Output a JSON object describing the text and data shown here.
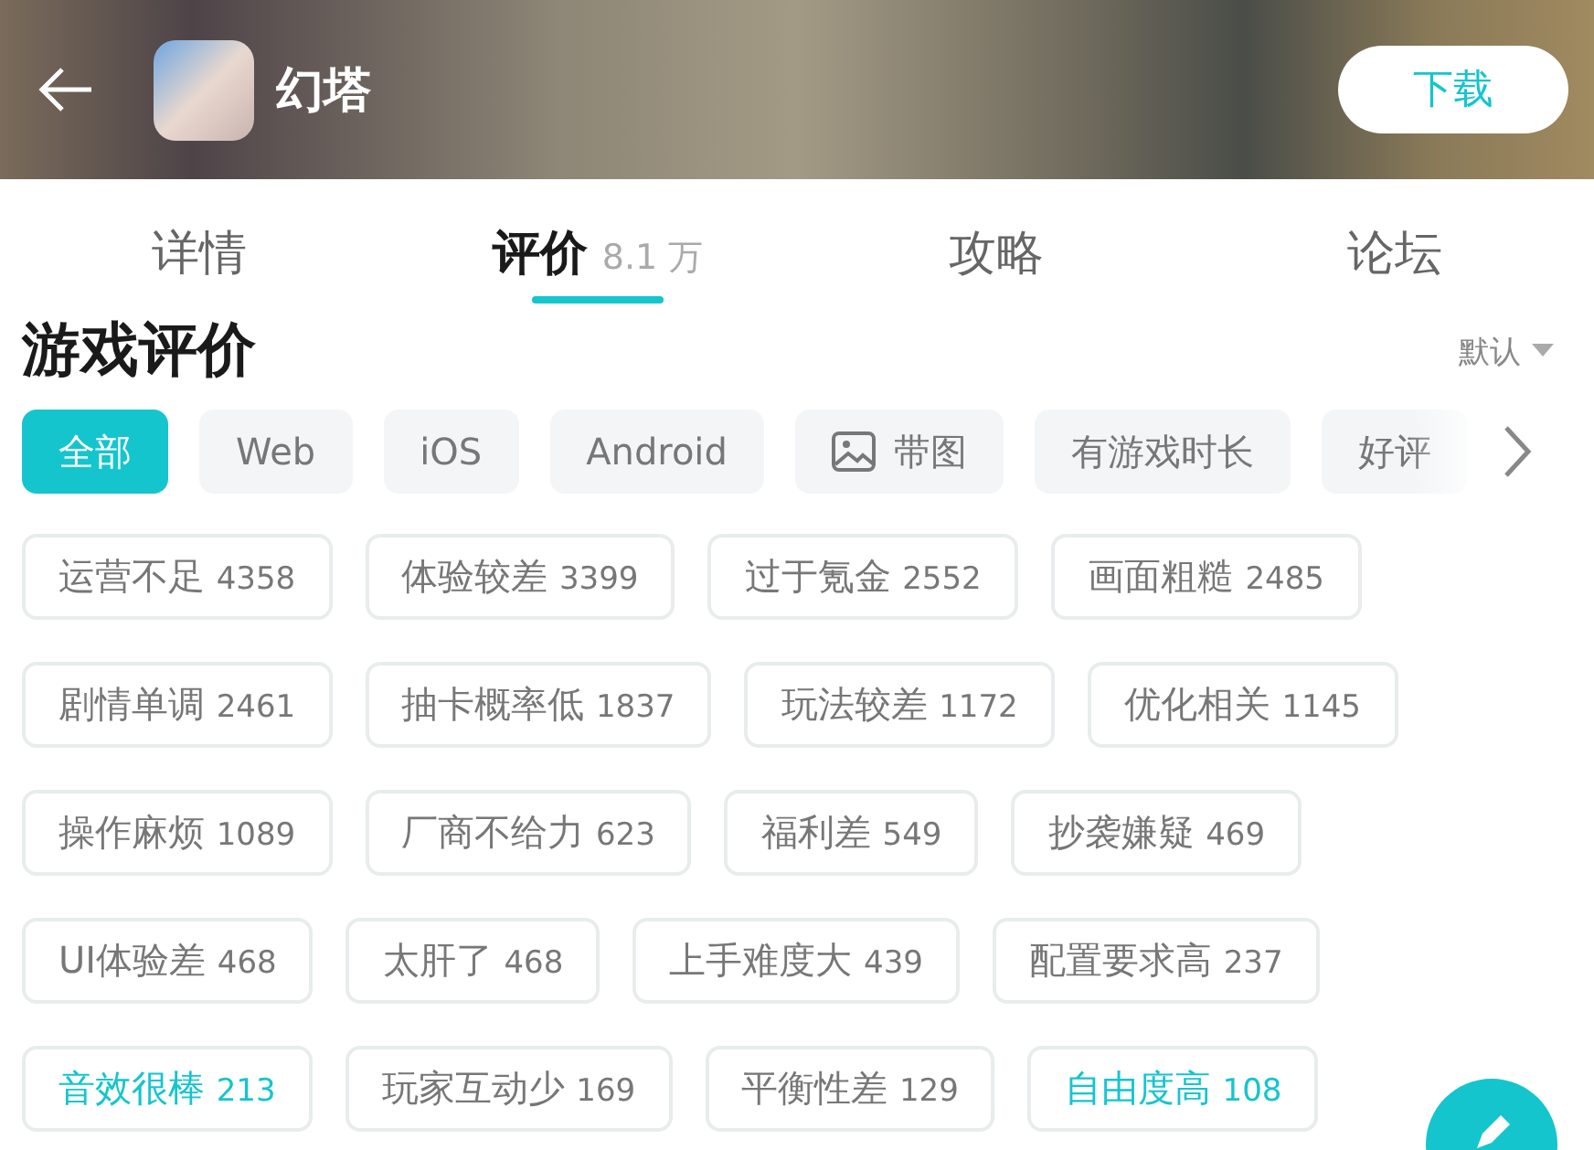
{
  "header": {
    "title": "幻塔",
    "download_button": "下载"
  },
  "tabs": [
    {
      "label": "详情",
      "selected": false
    },
    {
      "label": "评价",
      "count": "8.1 万",
      "selected": true
    },
    {
      "label": "攻略",
      "selected": false
    },
    {
      "label": "论坛",
      "selected": false
    }
  ],
  "section": {
    "title": "游戏评价",
    "sort": "默认"
  },
  "filters": [
    {
      "label": "全部",
      "kind": "text",
      "selected": true
    },
    {
      "label": "Web",
      "kind": "text",
      "selected": false
    },
    {
      "label": "iOS",
      "kind": "text",
      "selected": false
    },
    {
      "label": "Android",
      "kind": "text",
      "selected": false
    },
    {
      "label": "带图",
      "kind": "image",
      "selected": false
    },
    {
      "label": "有游戏时长",
      "kind": "text",
      "selected": false
    },
    {
      "label": "好评",
      "kind": "text",
      "selected": false
    }
  ],
  "tags": [
    {
      "label": "运营不足",
      "count": "4358",
      "kind": "negative"
    },
    {
      "label": "体验较差",
      "count": "3399",
      "kind": "negative"
    },
    {
      "label": "过于氪金",
      "count": "2552",
      "kind": "negative"
    },
    {
      "label": "画面粗糙",
      "count": "2485",
      "kind": "negative"
    },
    {
      "label": "剧情单调",
      "count": "2461",
      "kind": "negative"
    },
    {
      "label": "抽卡概率低",
      "count": "1837",
      "kind": "negative"
    },
    {
      "label": "玩法较差",
      "count": "1172",
      "kind": "negative"
    },
    {
      "label": "优化相关",
      "count": "1145",
      "kind": "negative"
    },
    {
      "label": "操作麻烦",
      "count": "1089",
      "kind": "negative"
    },
    {
      "label": "厂商不给力",
      "count": "623",
      "kind": "negative"
    },
    {
      "label": "福利差",
      "count": "549",
      "kind": "negative"
    },
    {
      "label": "抄袭嫌疑",
      "count": "469",
      "kind": "negative"
    },
    {
      "label": "UI体验差",
      "count": "468",
      "kind": "negative"
    },
    {
      "label": "太肝了",
      "count": "468",
      "kind": "negative"
    },
    {
      "label": "上手难度大",
      "count": "439",
      "kind": "negative"
    },
    {
      "label": "配置要求高",
      "count": "237",
      "kind": "negative"
    },
    {
      "label": "音效很棒",
      "count": "213",
      "kind": "positive"
    },
    {
      "label": "玩家互动少",
      "count": "169",
      "kind": "negative"
    },
    {
      "label": "平衡性差",
      "count": "129",
      "kind": "negative"
    },
    {
      "label": "自由度高",
      "count": "108",
      "kind": "positive"
    }
  ]
}
